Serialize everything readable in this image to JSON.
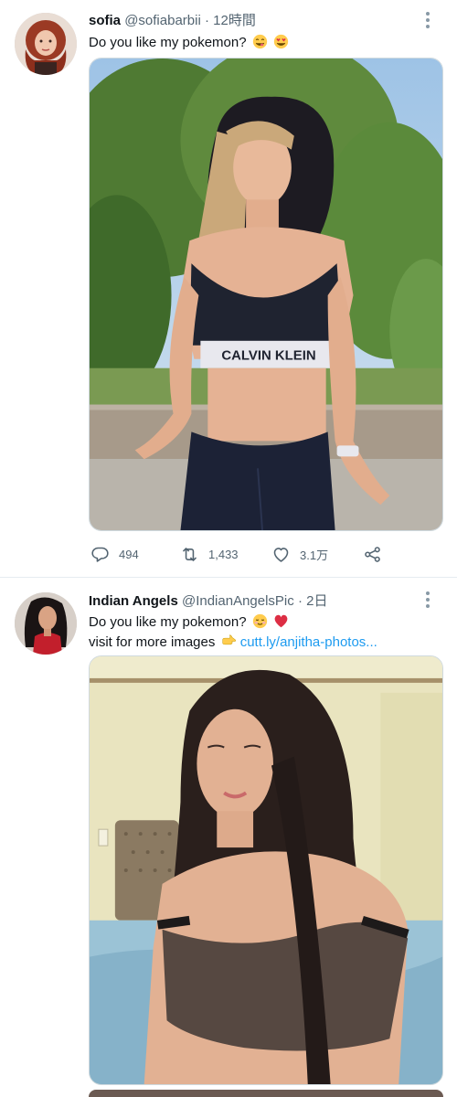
{
  "tweets": [
    {
      "name": "sofia",
      "handle": "@sofiabarbii",
      "separator": "·",
      "time": "12時間",
      "lines": [
        "Do you like my pokemon?"
      ],
      "emojis": [
        "yum-face-emoji",
        "heart-eyes-emoji"
      ],
      "media": {
        "description_icon": "photo",
        "shirt_text": "CALVIN KLEIN"
      },
      "stats": {
        "replies": "494",
        "retweets": "1,433",
        "likes": "3.1万"
      }
    },
    {
      "name": "Indian Angels",
      "handle": "@IndianAngelsPic",
      "separator": "·",
      "time": "2日",
      "lines": [
        "Do you like my pokemon?",
        "visit for more images"
      ],
      "link": "cutt.ly/anjitha-photos...",
      "emojis": [
        "smiling-face-emoji",
        "red-heart-emoji",
        "pointing-right-emoji"
      ]
    }
  ],
  "icons": {
    "reply": "reply-icon",
    "retweet": "retweet-icon",
    "like": "heart-icon",
    "share": "share-icon",
    "more": "more-icon"
  },
  "colors": {
    "link": "#1d9bf0",
    "muted": "#536471",
    "like_red": "#e0245e"
  }
}
